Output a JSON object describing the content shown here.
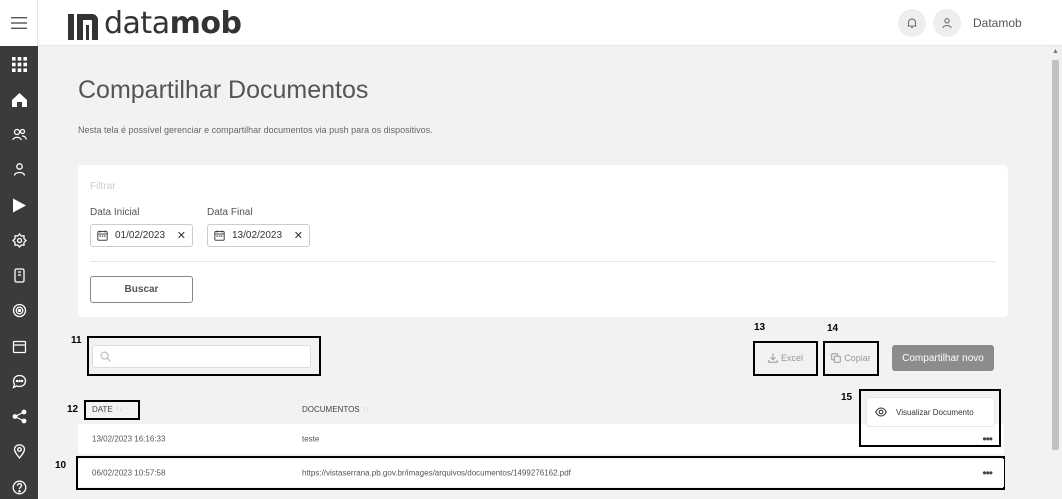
{
  "header": {
    "logo_text_light": "data",
    "logo_text_bold": "mob",
    "user_name": "Datamob"
  },
  "page": {
    "title": "Compartilhar Documentos",
    "description": "Nesta tela é possível gerenciar e compartilhar documentos via push para os dispositivos."
  },
  "filter": {
    "title": "Filtrar",
    "start_label": "Data Inicial",
    "start_value": "01/02/2023",
    "end_label": "Data Final",
    "end_value": "13/02/2023",
    "clear_glyph": "✕",
    "search_button": "Buscar"
  },
  "toolbar": {
    "search_placeholder": "",
    "excel_label": "Excel",
    "copy_label": "Copiar",
    "share_new_label": "Compartilhar novo"
  },
  "table": {
    "columns": [
      "DATE",
      "DOCUMENTOS"
    ],
    "sort_glyph": "↑↓",
    "rows": [
      {
        "date": "13/02/2023 16:16:33",
        "document": "teste"
      },
      {
        "date": "06/02/2023 10:57:58",
        "document": "https://vistaserrana.pb.gov.br/images/arquivos/documentos/1499276162.pdf"
      }
    ],
    "row_menu_glyph": "•••"
  },
  "row_menu": {
    "view_document": "Visualizar Documento"
  },
  "annotations": {
    "n10": "10",
    "n11": "11",
    "n12": "12",
    "n13": "13",
    "n14": "14",
    "n15": "15"
  },
  "sidebar": {
    "icons": [
      "menu-icon",
      "grid-icon",
      "home-icon",
      "users-icon",
      "user-icon",
      "play-icon",
      "gear-icon",
      "tablet-icon",
      "target-icon",
      "calendar-icon",
      "chat-icon",
      "share-icon",
      "location-icon",
      "help-icon"
    ]
  },
  "colors": {
    "sidebar": "#3b3b3b",
    "primary_button": "#8c8c8c",
    "background": "#f2f2f2"
  }
}
